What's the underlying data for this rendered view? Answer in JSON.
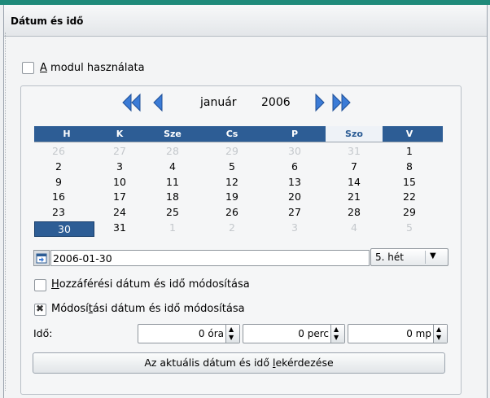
{
  "header": {
    "title": "Dátum és idő"
  },
  "module_checkbox": {
    "label_accel": "A",
    "label_rest": " modul használata",
    "checked": false
  },
  "nav": {
    "prev_year": "«",
    "prev_month": "‹",
    "month": "január",
    "year": "2006",
    "next_month": "›",
    "next_year": "»"
  },
  "weekdays": [
    "H",
    "K",
    "Sze",
    "Cs",
    "P",
    "Szo",
    "V"
  ],
  "weeks": [
    [
      {
        "d": "26",
        "dim": true
      },
      {
        "d": "27",
        "dim": true
      },
      {
        "d": "28",
        "dim": true
      },
      {
        "d": "29",
        "dim": true
      },
      {
        "d": "30",
        "dim": true
      },
      {
        "d": "31",
        "dim": true
      },
      {
        "d": "1"
      }
    ],
    [
      {
        "d": "2"
      },
      {
        "d": "3"
      },
      {
        "d": "4"
      },
      {
        "d": "5"
      },
      {
        "d": "6"
      },
      {
        "d": "7"
      },
      {
        "d": "8"
      }
    ],
    [
      {
        "d": "9"
      },
      {
        "d": "10"
      },
      {
        "d": "11"
      },
      {
        "d": "12"
      },
      {
        "d": "13"
      },
      {
        "d": "14"
      },
      {
        "d": "15"
      }
    ],
    [
      {
        "d": "16"
      },
      {
        "d": "17"
      },
      {
        "d": "18"
      },
      {
        "d": "19"
      },
      {
        "d": "20"
      },
      {
        "d": "21"
      },
      {
        "d": "22"
      }
    ],
    [
      {
        "d": "23"
      },
      {
        "d": "24"
      },
      {
        "d": "25"
      },
      {
        "d": "26"
      },
      {
        "d": "27"
      },
      {
        "d": "28"
      },
      {
        "d": "29"
      }
    ],
    [
      {
        "d": "30",
        "selected": true
      },
      {
        "d": "31"
      },
      {
        "d": "1",
        "dim": true
      },
      {
        "d": "2",
        "dim": true
      },
      {
        "d": "3",
        "dim": true
      },
      {
        "d": "4",
        "dim": true
      },
      {
        "d": "5",
        "dim": true
      }
    ]
  ],
  "date_field": {
    "value": "2006-01-30"
  },
  "week_select": {
    "value": "5. hét"
  },
  "access_checkbox": {
    "label_accel": "H",
    "label_rest": "ozzáférési dátum és idő módosítása",
    "checked": false
  },
  "modify_checkbox": {
    "label_pre": "Módosí",
    "label_accel": "t",
    "label_rest": "ási dátum és idő módosítása",
    "checked": true
  },
  "time": {
    "label": "Idő:",
    "hours": "0 óra",
    "minutes": "0 perc",
    "seconds": "0 mp"
  },
  "current_button": {
    "label_pre": "Az aktuális dátum és idő ",
    "label_accel": "l",
    "label_rest": "ekérdezése"
  },
  "colors": {
    "accent": "#2d5d95",
    "nav_arrow": "#3b7bd6",
    "topbar": "#1f8a7a"
  }
}
